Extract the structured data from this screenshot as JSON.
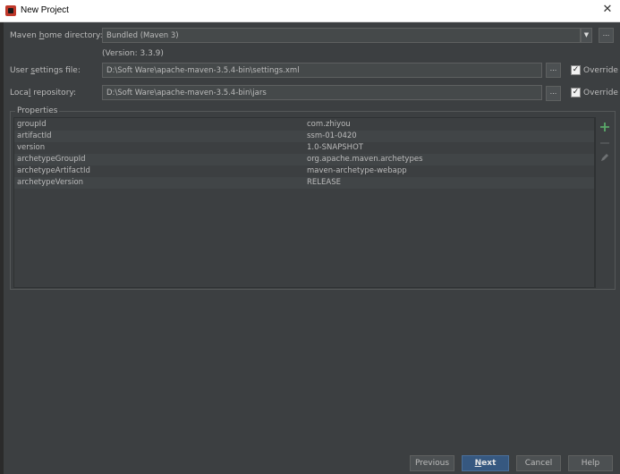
{
  "window": {
    "title": "New Project",
    "close_glyph": "✕"
  },
  "maven": {
    "home_label_pre": "Maven ",
    "home_label_ul": "h",
    "home_label_post": "ome directory:",
    "home_value": "Bundled (Maven 3)",
    "version_text": "(Version: 3.3.9)",
    "settings_label_pre": "User ",
    "settings_label_ul": "s",
    "settings_label_post": "ettings file:",
    "settings_value": "D:\\Soft Ware\\apache-maven-3.5.4-bin\\settings.xml",
    "repo_label_pre": "Loca",
    "repo_label_ul": "l",
    "repo_label_post": " repository:",
    "repo_value": "D:\\Soft Ware\\apache-maven-3.5.4-bin\\jars",
    "browse_label": "...",
    "override_label": "Override",
    "override_settings_checked": true,
    "override_repo_checked": true,
    "check_glyph": "✓",
    "dropdown_glyph": "▼"
  },
  "properties": {
    "title": "Properties",
    "rows": [
      {
        "key": "groupId",
        "value": "com.zhiyou"
      },
      {
        "key": "artifactId",
        "value": "ssm-01-0420"
      },
      {
        "key": "version",
        "value": "1.0-SNAPSHOT"
      },
      {
        "key": "archetypeGroupId",
        "value": "org.apache.maven.archetypes"
      },
      {
        "key": "archetypeArtifactId",
        "value": "maven-archetype-webapp"
      },
      {
        "key": "archetypeVersion",
        "value": "RELEASE"
      }
    ],
    "tools": {
      "add_icon": "plus-icon",
      "remove_icon": "minus-icon",
      "edit_icon": "pencil-icon",
      "add_color": "#59a869"
    }
  },
  "footer": {
    "previous": "Previous",
    "next_ul": "N",
    "next_rest": "ext",
    "cancel": "Cancel",
    "help": "Help"
  }
}
